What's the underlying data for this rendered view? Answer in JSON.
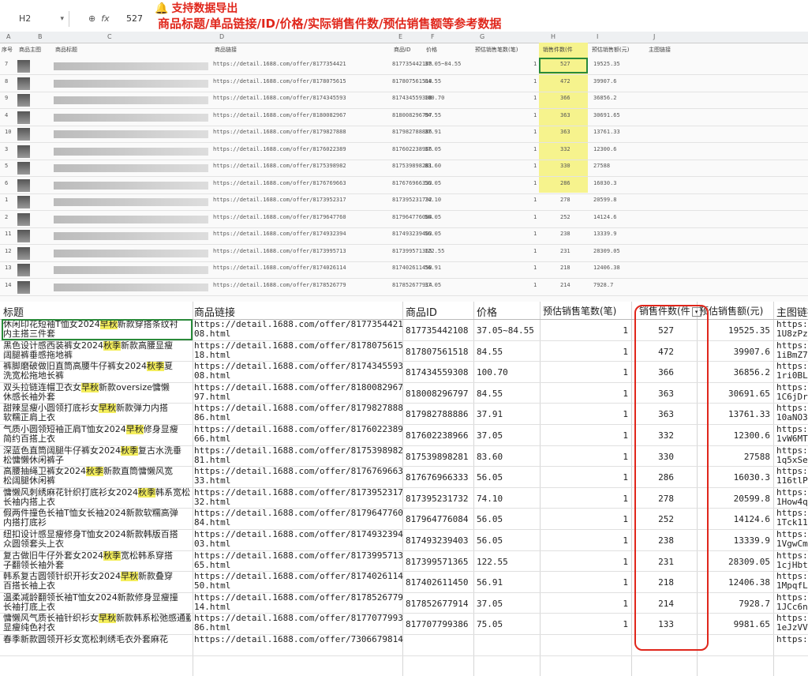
{
  "formula_bar": {
    "cell": "H2",
    "fx": "fx",
    "value": "527"
  },
  "banner": {
    "line1": "支持数据导出",
    "line2": "商品标题/单品链接/ID/价格/实际销售件数/预估销售额等参考数据"
  },
  "top_sheet": {
    "col_letters": [
      "A",
      "B",
      "C",
      "D",
      "E",
      "F",
      "G",
      "H",
      "I",
      "J"
    ],
    "headers": [
      "序号",
      "商品主图",
      "商品标题",
      "商品链接",
      "商品ID",
      "价格",
      "预估销售笔数(笔)",
      "销售件数(件",
      "预估销售额(元)",
      "主图链接"
    ],
    "rows": [
      {
        "no": "7",
        "link": "https://detail.1688.com/offer/8177354421",
        "id": "817735442108",
        "price": "37.05~84.55",
        "orders": "1",
        "sold": "527",
        "est": "19525.35"
      },
      {
        "no": "8",
        "link": "https://detail.1688.com/offer/8178075615",
        "id": "817807561518",
        "price": "84.55",
        "orders": "1",
        "sold": "472",
        "est": "39907.6"
      },
      {
        "no": "9",
        "link": "https://detail.1688.com/offer/8174345593",
        "id": "817434559308",
        "price": "100.70",
        "orders": "1",
        "sold": "366",
        "est": "36856.2"
      },
      {
        "no": "4",
        "link": "https://detail.1688.com/offer/8180082967",
        "id": "818008296797",
        "price": "84.55",
        "orders": "1",
        "sold": "363",
        "est": "30691.65"
      },
      {
        "no": "10",
        "link": "https://detail.1688.com/offer/8179827888",
        "id": "817982788886",
        "price": "37.91",
        "orders": "1",
        "sold": "363",
        "est": "13761.33"
      },
      {
        "no": "3",
        "link": "https://detail.1688.com/offer/8176022389",
        "id": "817602238966",
        "price": "37.05",
        "orders": "1",
        "sold": "332",
        "est": "12300.6"
      },
      {
        "no": "5",
        "link": "https://detail.1688.com/offer/8175398982",
        "id": "817539898281",
        "price": "83.60",
        "orders": "1",
        "sold": "330",
        "est": "27588"
      },
      {
        "no": "6",
        "link": "https://detail.1688.com/offer/8176769663",
        "id": "817676966333",
        "price": "56.05",
        "orders": "1",
        "sold": "286",
        "est": "16030.3"
      },
      {
        "no": "1",
        "link": "https://detail.1688.com/offer/8173952317",
        "id": "817395231732",
        "price": "74.10",
        "orders": "1",
        "sold": "278",
        "est": "20599.8"
      },
      {
        "no": "2",
        "link": "https://detail.1688.com/offer/8179647760",
        "id": "817964776084",
        "price": "56.05",
        "orders": "1",
        "sold": "252",
        "est": "14124.6"
      },
      {
        "no": "11",
        "link": "https://detail.1688.com/offer/8174932394",
        "id": "817493239403",
        "price": "56.05",
        "orders": "1",
        "sold": "238",
        "est": "13339.9"
      },
      {
        "no": "12",
        "link": "https://detail.1688.com/offer/8173995713",
        "id": "817399571365",
        "price": "122.55",
        "orders": "1",
        "sold": "231",
        "est": "28309.05"
      },
      {
        "no": "13",
        "link": "https://detail.1688.com/offer/8174026114",
        "id": "817402611450",
        "price": "56.91",
        "orders": "1",
        "sold": "218",
        "est": "12406.38"
      },
      {
        "no": "14",
        "link": "https://detail.1688.com/offer/8178526779",
        "id": "817852677914",
        "price": "37.05",
        "orders": "1",
        "sold": "214",
        "est": "7928.7"
      }
    ]
  },
  "main_table": {
    "headers": {
      "title": "标题",
      "link": "商品链接",
      "id": "商品ID",
      "price": "价格",
      "orders": "预估销售笔数(笔)",
      "sold": "销售件数(件",
      "est": "预估销售额(元)",
      "img": "主图链接"
    },
    "rows": [
      {
        "t1": "休闲印花短袖T恤女2024早秋新款穿搭条纹衬",
        "t2": "内主搭三件套",
        "l1": "https://detail.1688.com/offer/8177354421",
        "l2": "08.html",
        "id": "817735442108",
        "price": "37.05~84.55",
        "orders": "1",
        "sold": "527",
        "est": "19525.35",
        "i1": "https://",
        "i2": "1U8zPz"
      },
      {
        "t1": "黑色设计感西装裤女2024秋季新款高腰显瘦",
        "t2": "阔腿裤垂感拖地裤",
        "l1": "https://detail.1688.com/offer/8178075615",
        "l2": "18.html",
        "id": "817807561518",
        "price": "84.55",
        "orders": "1",
        "sold": "472",
        "est": "39907.6",
        "i1": "https://",
        "i2": "1iBmZ7"
      },
      {
        "t1": "裤脚磨破做旧直筒高腰牛仔裤女2024秋季夏",
        "t2": "洗宽松拖地长裤",
        "l1": "https://detail.1688.com/offer/8174345593",
        "l2": "08.html",
        "id": "817434559308",
        "price": "100.70",
        "orders": "1",
        "sold": "366",
        "est": "36856.2",
        "i1": "https://",
        "i2": "1ri0BLX"
      },
      {
        "t1": "双头拉链连帽卫衣女早秋新款oversize慵懒",
        "t2": "休感长袖外套",
        "l1": "https://detail.1688.com/offer/8180082967",
        "l2": "97.html",
        "id": "818008296797",
        "price": "84.55",
        "orders": "1",
        "sold": "363",
        "est": "30691.65",
        "i1": "https://",
        "i2": "1C6jDr"
      },
      {
        "t1": "甜辣显瘦小圆领打底衫女早秋新款弹力内搭",
        "t2": "软糯正肩上衣",
        "l1": "https://detail.1688.com/offer/8179827888",
        "l2": "86.html",
        "id": "817982788886",
        "price": "37.91",
        "orders": "1",
        "sold": "363",
        "est": "13761.33",
        "i1": "https://",
        "i2": "10aNO3"
      },
      {
        "t1": "气质小圆领短袖正肩T恤女2024早秋修身显瘦",
        "t2": "简约百搭上衣",
        "l1": "https://detail.1688.com/offer/8176022389",
        "l2": "66.html",
        "id": "817602238966",
        "price": "37.05",
        "orders": "1",
        "sold": "332",
        "est": "12300.6",
        "i1": "https://",
        "i2": "1vW6MT"
      },
      {
        "t1": "深蓝色直筒阔腿牛仔裤女2024秋季复古水洗垂",
        "t2": "松慵懒休闲裤子",
        "l1": "https://detail.1688.com/offer/8175398982",
        "l2": "81.html",
        "id": "817539898281",
        "price": "83.60",
        "orders": "1",
        "sold": "330",
        "est": "27588",
        "i1": "https://",
        "i2": "1q5xSe"
      },
      {
        "t1": "高腰抽绳卫裤女2024秋季新款直筒慵懒风宽",
        "t2": "松阔腿休闲裤",
        "l1": "https://detail.1688.com/offer/8176769663",
        "l2": "33.html",
        "id": "817676966333",
        "price": "56.05",
        "orders": "1",
        "sold": "286",
        "est": "16030.3",
        "i1": "https://",
        "i2": "116tlP"
      },
      {
        "t1": "慵懒风刺绣麻花针织打底衫女2024秋季韩系宽松",
        "t2": "长袖内搭上衣",
        "l1": "https://detail.1688.com/offer/8173952317",
        "l2": "32.html",
        "id": "817395231732",
        "price": "74.10",
        "orders": "1",
        "sold": "278",
        "est": "20599.8",
        "i1": "https://",
        "i2": "1How4q"
      },
      {
        "t1": "假两件撞色长袖T恤女长袖2024新款软糯高弹",
        "t2": "内搭打底衫",
        "l1": "https://detail.1688.com/offer/8179647760",
        "l2": "84.html",
        "id": "817964776084",
        "price": "56.05",
        "orders": "1",
        "sold": "252",
        "est": "14124.6",
        "i1": "https://",
        "i2": "1Tck11"
      },
      {
        "t1": "纽扣设计感显瘦修身T恤女2024新款韩版百搭",
        "t2": "众圆领套头上衣",
        "l1": "https://detail.1688.com/offer/8174932394",
        "l2": "03.html",
        "id": "817493239403",
        "price": "56.05",
        "orders": "1",
        "sold": "238",
        "est": "13339.9",
        "i1": "https://",
        "i2": "1VgwCm"
      },
      {
        "t1": "复古做旧牛仔外套女2024秋季宽松韩系穿搭",
        "t2": "子翻领长袖外套",
        "l1": "https://detail.1688.com/offer/8173995713",
        "l2": "65.html",
        "id": "817399571365",
        "price": "122.55",
        "orders": "1",
        "sold": "231",
        "est": "28309.05",
        "i1": "https://",
        "i2": "1cjHbt"
      },
      {
        "t1": "韩系复古圆领针织开衫女2024早秋新款叠穿",
        "t2": "百搭长袖上衣",
        "l1": "https://detail.1688.com/offer/8174026114",
        "l2": "50.html",
        "id": "817402611450",
        "price": "56.91",
        "orders": "1",
        "sold": "218",
        "est": "12406.38",
        "i1": "https://",
        "i2": "1MpqfL"
      },
      {
        "t1": "温柔减龄翻领长袖T恤女2024新款修身显瘦撞",
        "t2": "长袖打底上衣",
        "l1": "https://detail.1688.com/offer/8178526779",
        "l2": "14.html",
        "id": "817852677914",
        "price": "37.05",
        "orders": "1",
        "sold": "214",
        "est": "7928.7",
        "i1": "https://",
        "i2": "1JCc6n"
      },
      {
        "t1": "慵懒风气质长袖针织衫女早秋新款韩系松弛感通勤",
        "t2": "显瘦纯色衬衣",
        "l1": "https://detail.1688.com/offer/8177077993",
        "l2": "86.html",
        "id": "817707799386",
        "price": "75.05",
        "orders": "1",
        "sold": "133",
        "est": "9981.65",
        "i1": "https://",
        "i2": "1eJzVV"
      },
      {
        "t1": "春季新款圆领开衫女宽松刺绣毛衣外套麻花",
        "t2": "",
        "l1": "https://detail.1688.com/offer/7306679814",
        "l2": "",
        "id": "",
        "price": "",
        "orders": "",
        "sold": "",
        "est": "",
        "i1": "https://",
        "i2": ""
      }
    ]
  }
}
